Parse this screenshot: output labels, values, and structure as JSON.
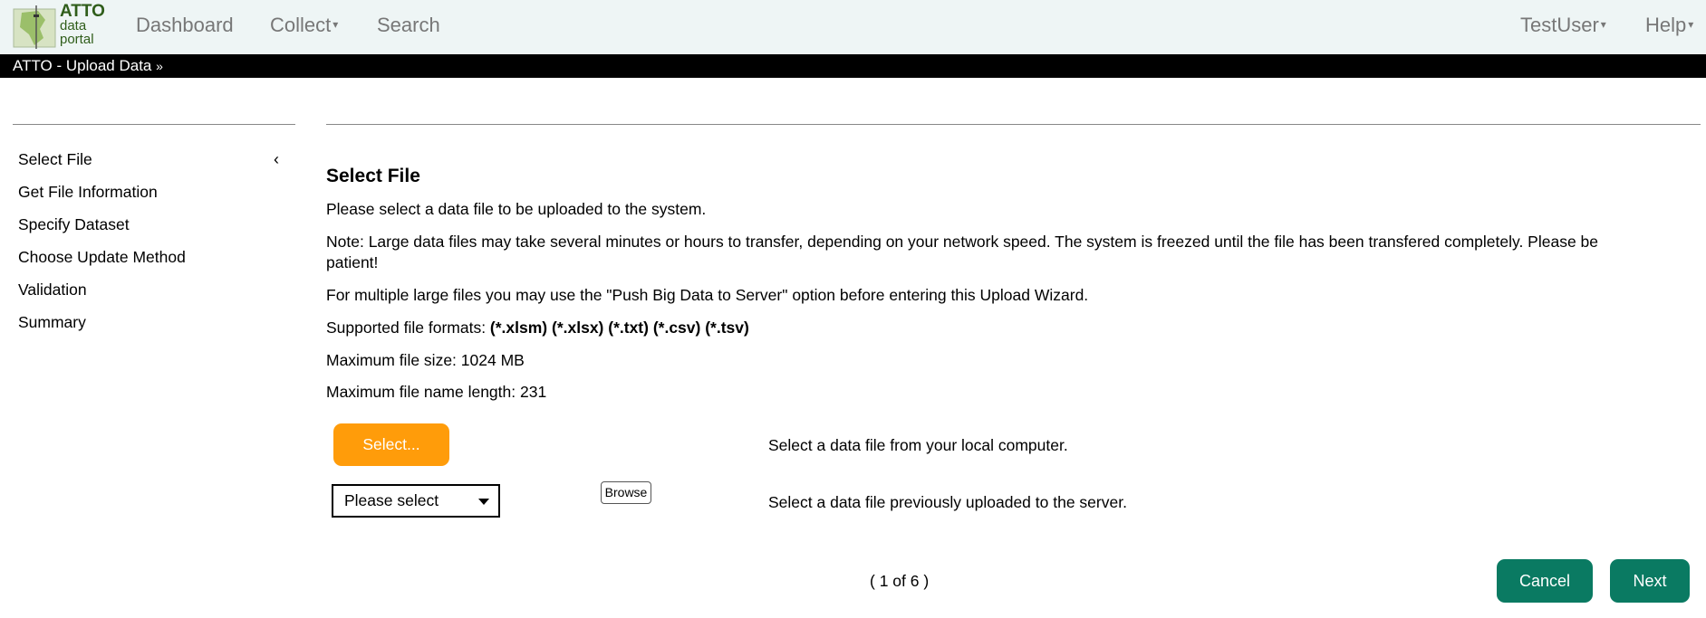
{
  "navbar": {
    "logo": {
      "line1": "ATTO",
      "line2": "data",
      "line3": "portal"
    },
    "items": [
      "Dashboard",
      "Collect",
      "Search"
    ],
    "user": "TestUser",
    "help": "Help"
  },
  "module_bar": {
    "label": "ATTO - Upload Data",
    "icon": "double-chevron-down-icon"
  },
  "steps": [
    {
      "label": "Select File",
      "active": true
    },
    {
      "label": "Get File Information"
    },
    {
      "label": "Specify Dataset"
    },
    {
      "label": "Choose Update Method"
    },
    {
      "label": "Validation"
    },
    {
      "label": "Summary"
    }
  ],
  "main": {
    "title": "Select File",
    "intro": "Please select a data file to be uploaded to the system.",
    "note_line1": "Note: Large data files may take several minutes or hours to transfer, depending on your network speed. The system is freezed until the file has been transfered completely. Please be",
    "note_line2": "patient!",
    "multi": "For multiple large files you may use the \"Push Big Data to Server\" option before entering this Upload Wizard.",
    "formats_label": "Supported file formats: ",
    "formats_value": "(*.xlsm) (*.xlsx) (*.txt) (*.csv) (*.tsv)",
    "max_size": "Maximum file size: 1024 MB",
    "max_name": "Maximum file name length: 231",
    "select_button": "Select...",
    "select_desc": "Select a data file from your local computer.",
    "dropdown_value": "Please select",
    "browse_button": "Browse",
    "server_desc": "Select a data file previously uploaded to the server."
  },
  "footer": {
    "pager": "( 1 of 6 )",
    "cancel": "Cancel",
    "next": "Next"
  },
  "colors": {
    "orange": "#ff9c0a",
    "green": "#0a7a62",
    "navbar_bg": "#eef5f5"
  }
}
